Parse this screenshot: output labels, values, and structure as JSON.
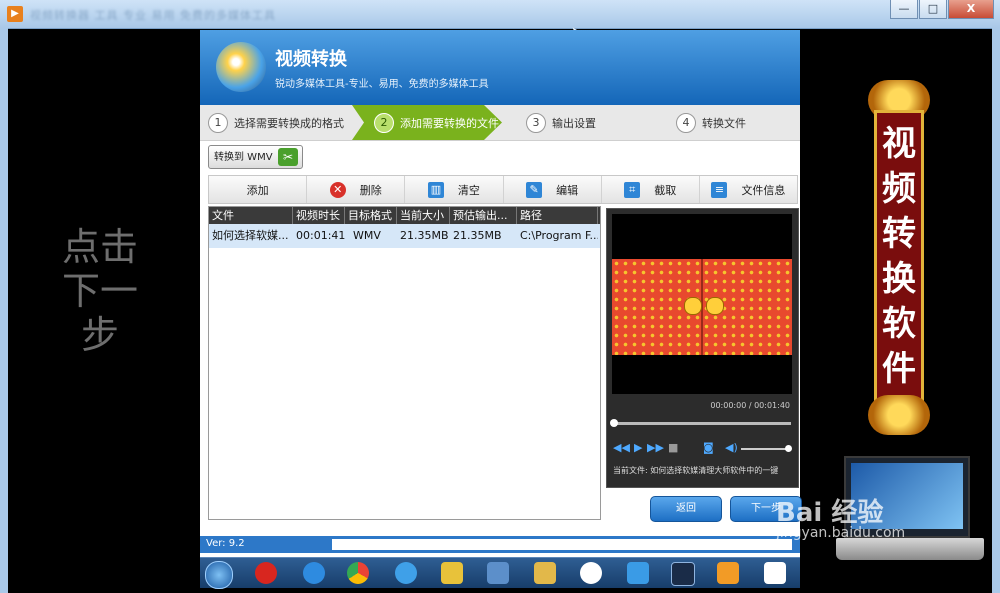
{
  "window": {
    "titlebar_blurred": "视频转换器 工具 专业 易用 免费的多媒体工具",
    "minimize": "—",
    "maximize": "□",
    "close": "X"
  },
  "side": {
    "left_text": "点击下一步",
    "banner_text": "视频转换软件"
  },
  "app": {
    "title": "视频转换",
    "subtitle": "锐动多媒体工具-专业、易用、免费的多媒体工具",
    "steps": [
      {
        "num": "1",
        "label": "选择需要转换成的格式"
      },
      {
        "num": "2",
        "label": "添加需要转换的文件"
      },
      {
        "num": "3",
        "label": "输出设置"
      },
      {
        "num": "4",
        "label": "转换文件"
      }
    ],
    "convert_to": "转换到 WMV",
    "toolbar": {
      "add": "添加",
      "delete": "删除",
      "clear": "清空",
      "edit": "编辑",
      "crop": "截取",
      "fileinfo": "文件信息"
    },
    "table": {
      "headers": [
        "文件",
        "视频时长",
        "目标格式",
        "当前大小",
        "预估输出...",
        "路径"
      ],
      "rows": [
        [
          "如何选择软媒...",
          "00:01:41",
          "WMV",
          "21.35MB",
          "21.35MB",
          "C:\\Program F..."
        ]
      ]
    },
    "preview": {
      "timecode": "00:00:00 / 00:01:40",
      "current_file": "当前文件: 如何选择软媒清理大师软件中的一键"
    },
    "back": "返回",
    "next": "下一步",
    "version": "Ver: 9.2"
  },
  "watermark": {
    "main": "Bai 经验",
    "sub": "jingyan.baidu.com"
  }
}
